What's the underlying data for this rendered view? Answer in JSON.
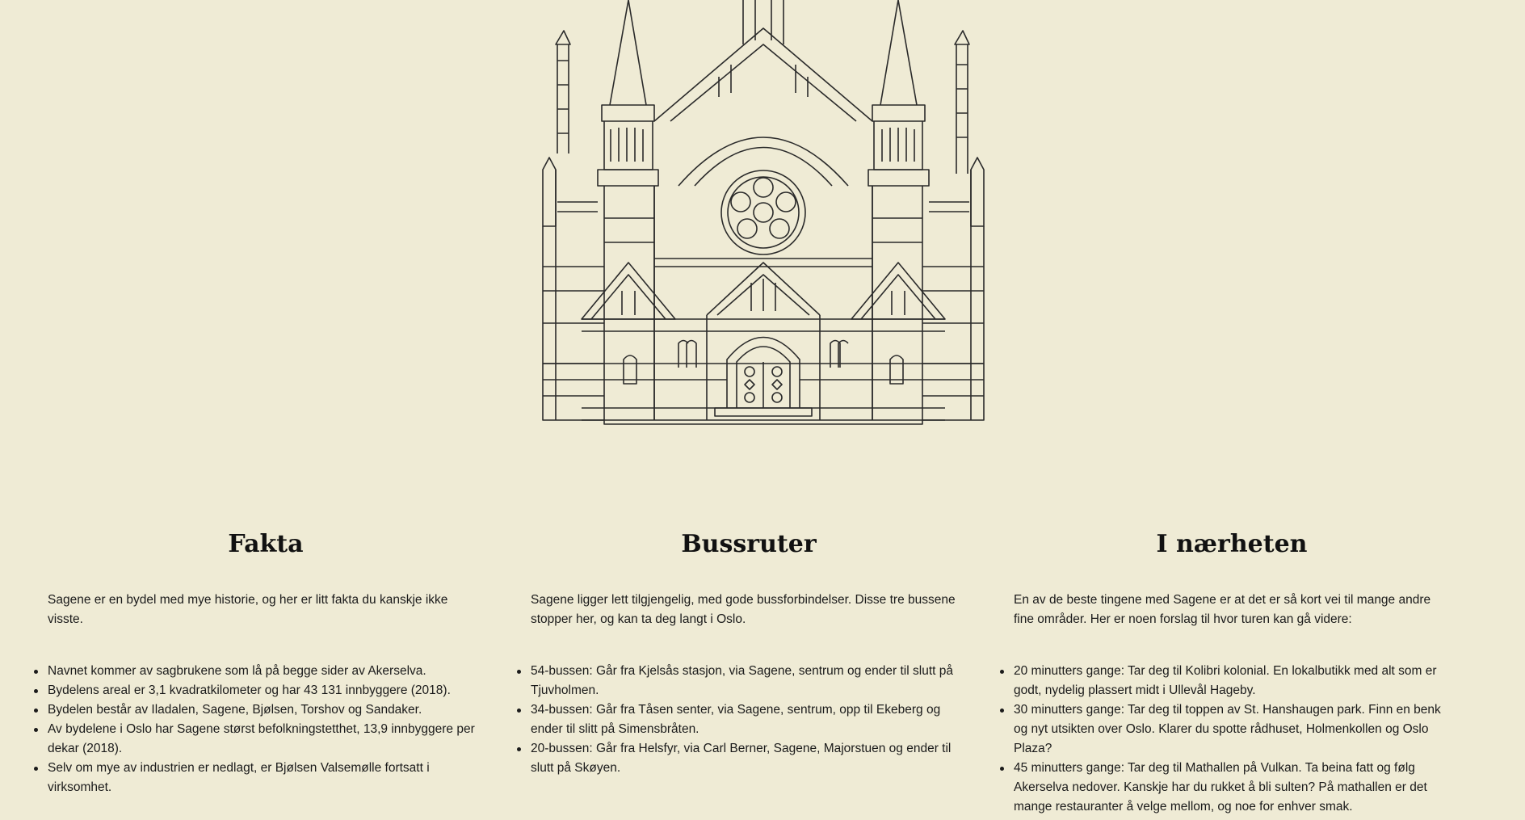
{
  "hero": {
    "illustration": "church-line-drawing"
  },
  "sections": [
    {
      "title": "Fakta",
      "intro": "Sagene er en bydel med mye historie, og her er litt fakta du kanskje ikke visste.",
      "items": [
        "Navnet kommer av sagbrukene som lå på begge sider av Akerselva.",
        "Bydelens areal er 3,1 kvadratkilometer og har 43 131 innbyggere (2018).",
        "Bydelen består av Iladalen, Sagene, Bjølsen, Torshov og Sandaker.",
        "Av bydelene i Oslo har Sagene størst befolkningstetthet, 13,9 innbyggere per dekar (2018).",
        "Selv om mye av industrien er nedlagt, er Bjølsen Valsemølle fortsatt i virksomhet."
      ]
    },
    {
      "title": "Bussruter",
      "intro": "Sagene ligger lett tilgjengelig, med gode bussforbindelser. Disse tre bussene stopper her, og kan ta deg langt i Oslo.",
      "items": [
        "54-bussen: Går fra Kjelsås stasjon, via Sagene, sentrum og ender til slutt på Tjuvholmen.",
        "34-bussen: Går fra Tåsen senter, via Sagene, sentrum, opp til Ekeberg og ender til slitt på Simensbråten.",
        "20-bussen: Går fra Helsfyr, via Carl Berner, Sagene, Majorstuen og ender til slutt på Skøyen."
      ]
    },
    {
      "title": "I nærheten",
      "intro": "En av de beste tingene med Sagene er at det er så kort vei til mange andre fine områder. Her er noen forslag til hvor turen kan gå videre:",
      "items": [
        "20 minutters gange: Tar deg til Kolibri kolonial. En lokalbutikk med alt som er godt, nydelig plassert midt i Ullevål Hageby.",
        "30 minutters gange: Tar deg til toppen av St. Hanshaugen park. Finn en benk og nyt utsikten over Oslo. Klarer du spotte rådhuset, Holmenkollen og Oslo Plaza?",
        "45 minutters gange: Tar deg til Mathallen på Vulkan. Ta beina fatt og følg Akerselva nedover. Kanskje har du rukket å bli sulten? På mathallen er det mange restauranter å velge mellom, og noe for enhver smak."
      ]
    }
  ]
}
